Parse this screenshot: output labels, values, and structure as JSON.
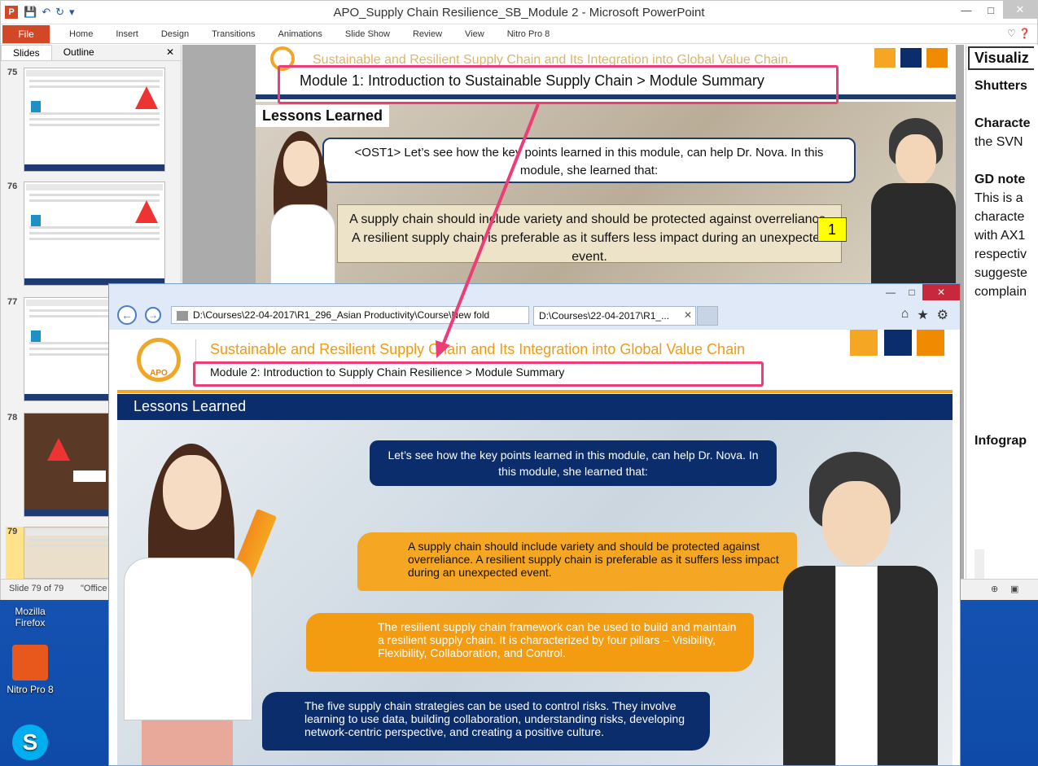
{
  "desktop": {
    "icons": [
      {
        "label": "Mozilla\nFirefox",
        "icon": "firefox-icon"
      },
      {
        "label": "Nitro Pro 8",
        "icon": "nitro-icon"
      },
      {
        "label": "",
        "icon": "skype-icon"
      }
    ]
  },
  "ppt": {
    "title": "APO_Supply Chain Resilience_SB_Module 2  -  Microsoft PowerPoint",
    "file_tab": "File",
    "tabs": [
      "Home",
      "Insert",
      "Design",
      "Transitions",
      "Animations",
      "Slide Show",
      "Review",
      "View",
      "Nitro Pro 8"
    ],
    "pane_tabs": [
      "Slides",
      "Outline"
    ],
    "slide_numbers": [
      "75",
      "76",
      "77",
      "78",
      "79"
    ],
    "status": {
      "slide": "Slide 79 of 79",
      "theme": "\"Office"
    },
    "slide": {
      "header": "Sustainable and Resilient Supply Chain and Its Integration into Global Value Chain.",
      "module": "Module 1: Introduction to Sustainable Supply Chain > Module Summary",
      "lessons": "Lessons Learned",
      "bubble": "<OST1> Let’s see how the key points learned in this module, can help Dr. Nova. In this module, she learned that:",
      "point1": "A supply chain should include variety and should be protected against overreliance. A resilient supply chain is preferable as it suffers less impact during an unexpected event.",
      "badge": "1"
    },
    "notes": {
      "title": "Visualiz",
      "l1": "Shutters",
      "l2": "Characte",
      "l3": "the SVN",
      "l4": "GD note",
      "l5": "This is a",
      "l6": "characte",
      "l7": "with AX1",
      "l8": "respectiv",
      "l9": "suggeste",
      "l10": "complain",
      "l11": "Infograp"
    }
  },
  "ie": {
    "address": "D:\\Courses\\22-04-2017\\R1_296_Asian Productivity\\Course\\New fold",
    "tab_label": "D:\\Courses\\22-04-2017\\R1_...",
    "content": {
      "logo_text": "APO",
      "title": "Sustainable and Resilient Supply Chain and Its Integration into Global Value Chain",
      "module": "Module 2: Introduction to Supply Chain Resilience > Module Summary",
      "lessons": "Lessons Learned",
      "bubble": "Let’s see how the key points learned in this module, can help Dr. Nova. In this module, she learned that:",
      "point1": "A supply chain should include variety and should be protected against overreliance. A resilient supply chain is preferable as it suffers less impact during an unexpected event.",
      "point2": "The resilient supply chain framework can be used to build and maintain a resilient supply chain. It is characterized by four pillars – Visibility, Flexibility, Collaboration, and Control.",
      "point3": "The five supply chain strategies can be used to control risks. They involve learning to use data, building collaboration, understanding risks, developing network-centric perspective, and creating a positive culture."
    }
  },
  "colors": {
    "accent": "#ee3c76",
    "navy": "#0c2d6b",
    "orange": "#f5a623"
  }
}
